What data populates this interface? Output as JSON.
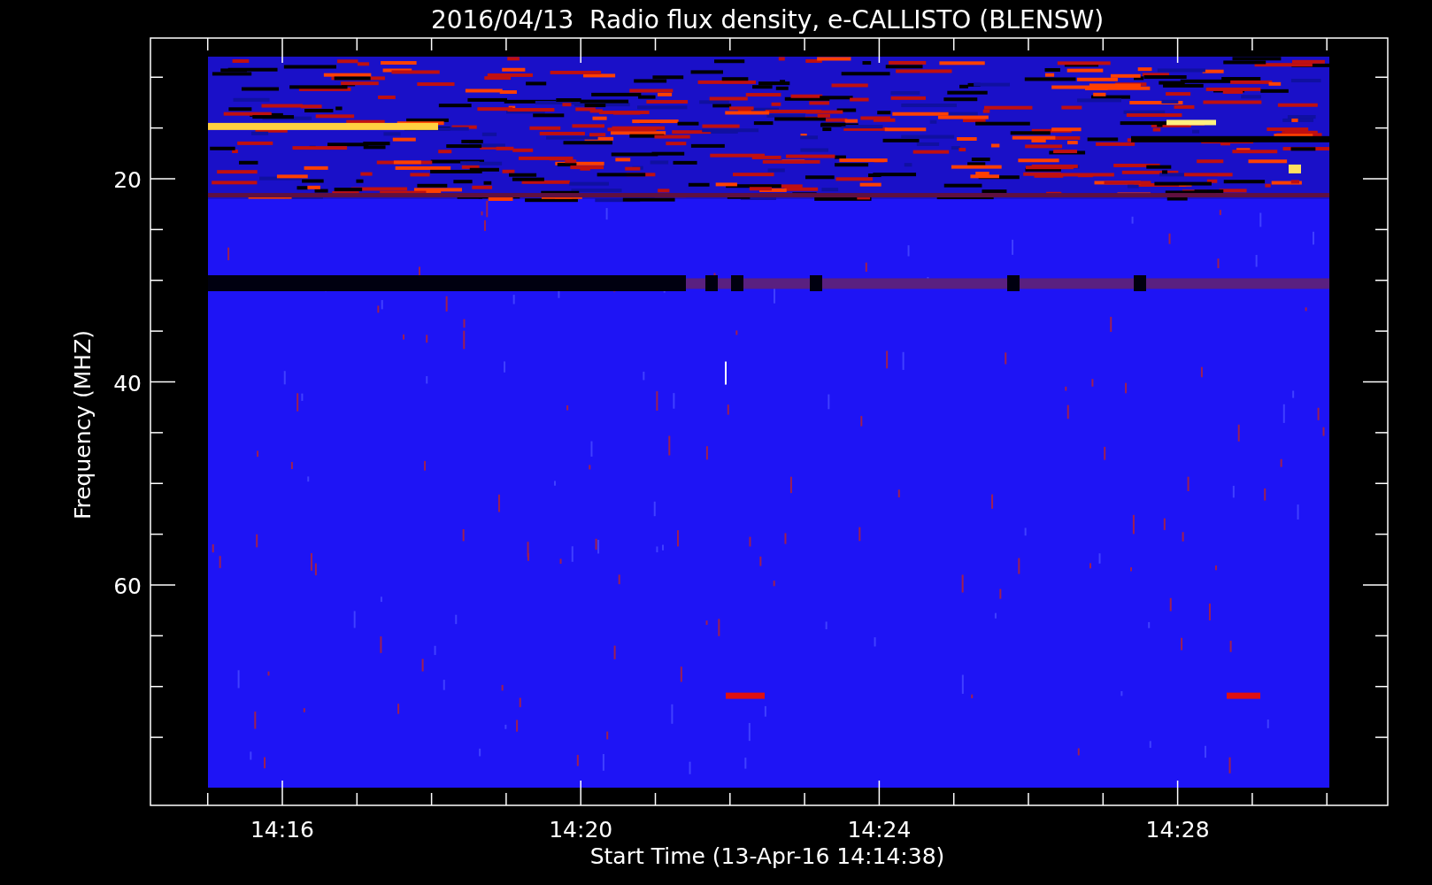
{
  "title": "2016/04/13  Radio flux density, e-CALLISTO (BLENSW)",
  "y_axis": {
    "label": "Frequency (MHZ)",
    "ticks": [
      "20",
      "40",
      "60"
    ]
  },
  "x_axis": {
    "label": "Start Time (13-Apr-16 14:14:38)",
    "ticks": [
      "14:16",
      "14:20",
      "14:24",
      "14:28"
    ]
  }
}
